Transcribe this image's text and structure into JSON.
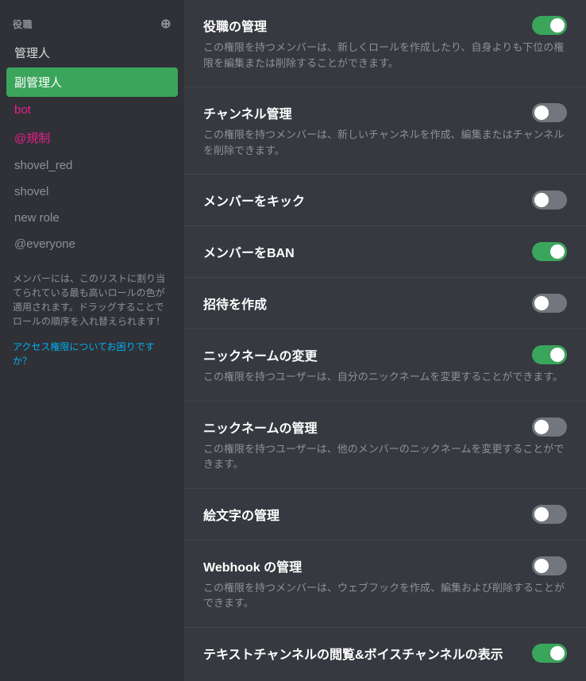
{
  "sidebar": {
    "section_label": "役職",
    "roles": [
      {
        "name": "管理人",
        "class": "role-管理人",
        "active": false
      },
      {
        "name": "副管理人",
        "class": "",
        "active": true
      },
      {
        "name": "bot",
        "class": "role-bot",
        "active": false
      },
      {
        "name": "@規制",
        "class": "role-mention",
        "active": false
      },
      {
        "name": "shovel_red",
        "class": "role-shovel_red",
        "active": false
      },
      {
        "name": "shovel",
        "class": "role-shovel",
        "active": false
      },
      {
        "name": "new role",
        "class": "role-new",
        "active": false
      },
      {
        "name": "@everyone",
        "class": "role-everyone",
        "active": false
      }
    ],
    "info_text": "メンバーには、このリストに割り当てられている最も高いロールの色が適用されます。ドラッグすることでロールの順序を入れ替えられます！",
    "link_text": "アクセス権限についてお困りですか？"
  },
  "permissions": [
    {
      "name": "役職の管理",
      "desc": "この権限を持つメンバーは、新しくロールを作成したり、自身よりも下位の権限を編集または削除することができます。",
      "state": "on"
    },
    {
      "name": "チャンネル管理",
      "desc": "この権限を持つメンバーは、新しいチャンネルを作成、編集またはチャンネルを削除できます。",
      "state": "off"
    },
    {
      "name": "メンバーをキック",
      "desc": "",
      "state": "off"
    },
    {
      "name": "メンバーをBAN",
      "desc": "",
      "state": "on"
    },
    {
      "name": "招待を作成",
      "desc": "",
      "state": "off"
    },
    {
      "name": "ニックネームの変更",
      "desc": "この権限を持つユーザーは、自分のニックネームを変更することができます。",
      "state": "on"
    },
    {
      "name": "ニックネームの管理",
      "desc": "この権限を持つユーザーは、他のメンバーのニックネームを変更することができます。",
      "state": "off"
    },
    {
      "name": "絵文字の管理",
      "desc": "",
      "state": "off"
    },
    {
      "name": "Webhook の管理",
      "desc": "この権限を持つメンバーは、ウェブフックを作成、編集および削除することができます。",
      "state": "off"
    },
    {
      "name": "テキストチャンネルの閲覧&ボイスチャンネルの表示",
      "desc": "",
      "state": "on"
    }
  ]
}
